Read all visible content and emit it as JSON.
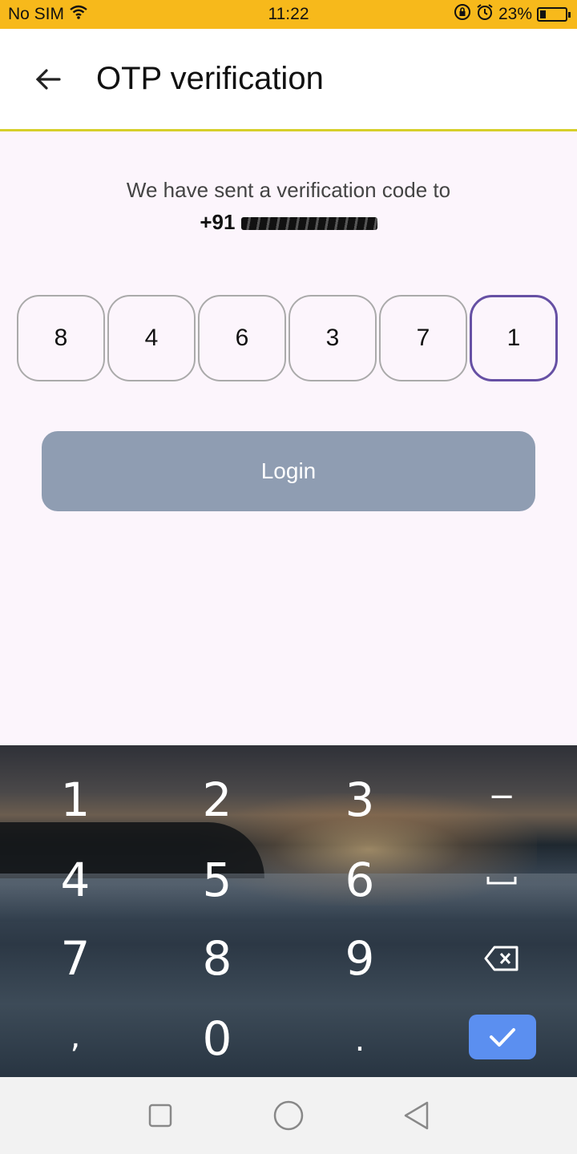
{
  "status_bar": {
    "carrier": "No SIM",
    "time": "11:22",
    "battery": "23%",
    "battery_level": 0.23
  },
  "header": {
    "title": "OTP verification"
  },
  "message": {
    "line1": "We have sent a verification code to",
    "country_code": "+91"
  },
  "otp": {
    "digits": [
      "8",
      "4",
      "6",
      "3",
      "7",
      "1"
    ],
    "active_index": 5
  },
  "login_button": {
    "label": "Login"
  },
  "keyboard": {
    "keys": [
      "1",
      "2",
      "3",
      "−",
      "4",
      "5",
      "6",
      "␣",
      "7",
      "8",
      "9",
      "⌫",
      ",",
      "0",
      "."
    ]
  },
  "colors": {
    "status_bar": "#f7b91b",
    "accent": "#6650a4",
    "button_disabled": "#8f9db2",
    "done_key": "#5b8ff0",
    "header_underline": "#d6cf2a"
  }
}
